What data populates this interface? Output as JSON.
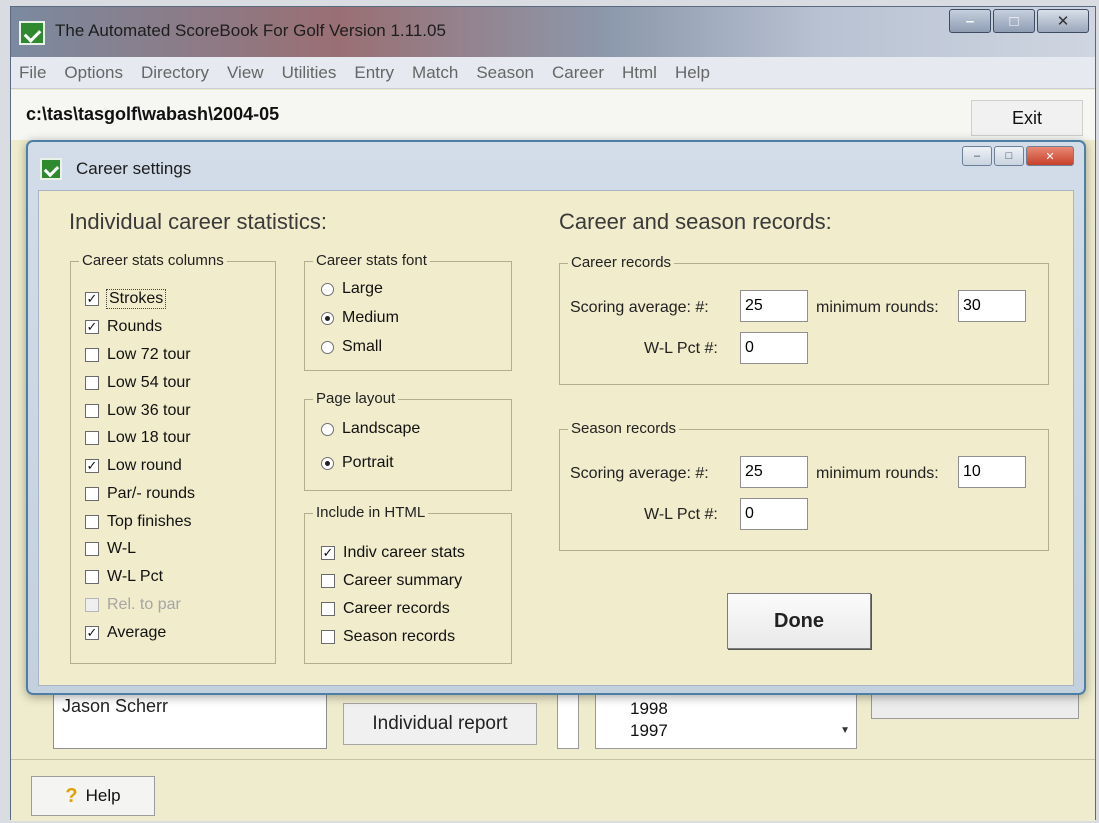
{
  "main_window": {
    "title": "The Automated ScoreBook For Golf  Version 1.11.05",
    "menu": [
      "File",
      "Options",
      "Directory",
      "View",
      "Utilities",
      "Entry",
      "Match",
      "Season",
      "Career",
      "Html",
      "Help"
    ],
    "path": "c:\\tas\\tasgolf\\wabash\\2004-05",
    "exit_label": "Exit",
    "player_name": "Jason Scherr",
    "individual_report_label": "Individual report",
    "season_years": [
      "1998",
      "1997"
    ],
    "help_label": "Help"
  },
  "dialog": {
    "title": "Career settings",
    "left_heading": "Individual career statistics:",
    "right_heading": "Career and season records:",
    "stats_columns": {
      "legend": "Career stats columns",
      "items": [
        {
          "label": "Strokes",
          "checked": true
        },
        {
          "label": "Rounds",
          "checked": true
        },
        {
          "label": "Low 72 tour",
          "checked": false
        },
        {
          "label": "Low 54 tour",
          "checked": false
        },
        {
          "label": "Low 36 tour",
          "checked": false
        },
        {
          "label": "Low 18 tour",
          "checked": false
        },
        {
          "label": "Low round",
          "checked": true
        },
        {
          "label": "Par/- rounds",
          "checked": false
        },
        {
          "label": "Top finishes",
          "checked": false
        },
        {
          "label": "W-L",
          "checked": false
        },
        {
          "label": "W-L Pct",
          "checked": false
        },
        {
          "label": "Rel. to par",
          "checked": false,
          "disabled": true
        },
        {
          "label": "Average",
          "checked": true
        }
      ]
    },
    "font_group": {
      "legend": "Career stats font",
      "options": [
        {
          "label": "Large",
          "selected": false
        },
        {
          "label": "Medium",
          "selected": true
        },
        {
          "label": "Small",
          "selected": false
        }
      ]
    },
    "layout_group": {
      "legend": "Page layout",
      "options": [
        {
          "label": "Landscape",
          "selected": false
        },
        {
          "label": "Portrait",
          "selected": true
        }
      ]
    },
    "html_group": {
      "legend": "Include in HTML",
      "items": [
        {
          "label": "Indiv career stats",
          "checked": true
        },
        {
          "label": "Career summary",
          "checked": false
        },
        {
          "label": "Career records",
          "checked": false
        },
        {
          "label": "Season records",
          "checked": false
        }
      ]
    },
    "career_records": {
      "legend": "Career records",
      "scoring_label": "Scoring average:  #:",
      "scoring_value": "25",
      "min_rounds_label": "minimum rounds:",
      "min_rounds_value": "30",
      "wl_label": "W-L Pct #:",
      "wl_value": "0"
    },
    "season_records": {
      "legend": "Season records",
      "scoring_label": "Scoring average:  #:",
      "scoring_value": "25",
      "min_rounds_label": "minimum rounds:",
      "min_rounds_value": "10",
      "wl_label": "W-L Pct #:",
      "wl_value": "0"
    },
    "done_label": "Done"
  }
}
